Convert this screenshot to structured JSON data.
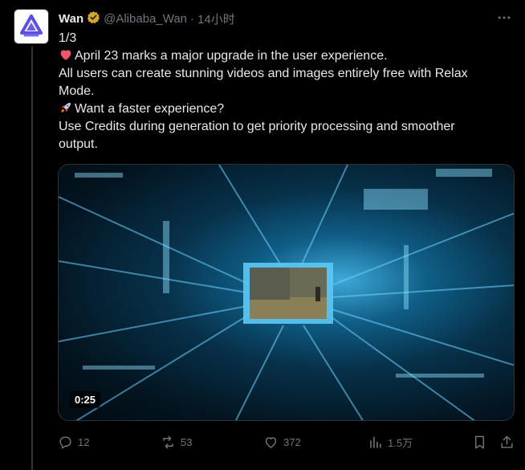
{
  "author": {
    "name": "Wan",
    "handle": "@Alibaba_Wan",
    "separator": "·",
    "time": "14小时",
    "verified_badge_color": "#d4a62a"
  },
  "post": {
    "counter": "1/3",
    "line1": "April 23 marks a major upgrade in the user experience.",
    "line1_emoji": "red-heart",
    "line2": "All users can create stunning videos and images entirely free with Relax",
    "line3": "Mode.",
    "line4": "Want a faster experience?",
    "line4_emoji": "rocket",
    "line5": "Use Credits during generation to get priority processing and smoother",
    "line6": "output."
  },
  "media": {
    "type": "video",
    "duration": "0:25"
  },
  "actions": {
    "replies": "12",
    "reposts": "53",
    "likes": "372",
    "views": "1.5万"
  },
  "icons": {
    "more": "more-icon",
    "reply": "reply-icon",
    "repost": "repost-icon",
    "like": "heart-icon",
    "views": "views-icon",
    "bookmark": "bookmark-icon",
    "share": "share-icon"
  },
  "colors": {
    "background": "#000000",
    "text": "#e7e9ea",
    "secondary_text": "#71767b",
    "accent_video": "#3fa9d8"
  }
}
